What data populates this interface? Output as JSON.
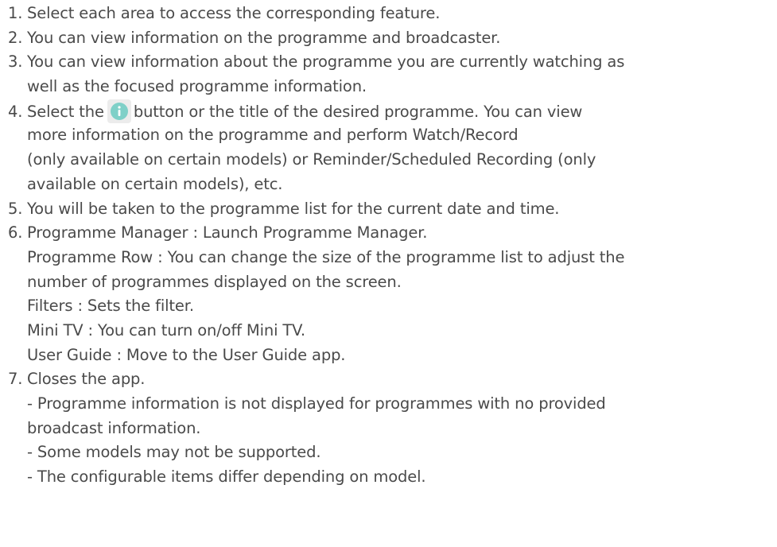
{
  "items": [
    {
      "num": "1.",
      "lines": [
        "Select each area to access the corresponding feature."
      ]
    },
    {
      "num": "2.",
      "lines": [
        "You can view information on the programme and broadcaster."
      ]
    },
    {
      "num": "3.",
      "lines": [
        "You can view information about the programme you are currently watching as",
        "well as the focused programme information."
      ]
    },
    {
      "num": "4.",
      "before_icon": "Select the",
      "after_icon": "button or the title of the desired programme. You can view",
      "lines": [
        "more information on the programme and perform Watch/Record",
        "(only available on certain models) or Reminder/Scheduled Recording (only",
        "available on certain models), etc."
      ]
    },
    {
      "num": "5.",
      "lines": [
        "You will be taken to the programme list for the current date and time."
      ]
    },
    {
      "num": "6.",
      "lines": [
        "Programme Manager : Launch Programme Manager.",
        "Programme Row : You can change the size of the programme list to adjust the",
        "number of programmes displayed on the screen.",
        "Filters : Sets the filter.",
        "Mini TV : You can turn on/off Mini TV.",
        "User Guide : Move to the User Guide app."
      ]
    },
    {
      "num": "7.",
      "lines": [
        "Closes the app.",
        "- Programme information is not displayed for programmes with no provided",
        "broadcast information.",
        "- Some models may not be supported.",
        "- The configurable items differ depending on model."
      ]
    }
  ],
  "icon": {
    "name": "info-icon",
    "color": "#7fd0c8"
  }
}
